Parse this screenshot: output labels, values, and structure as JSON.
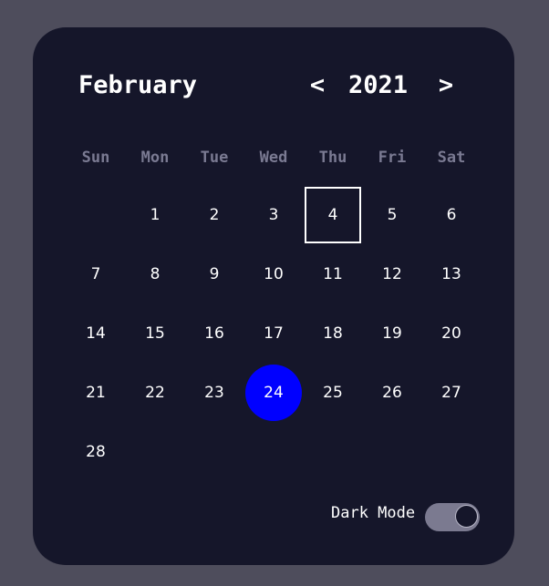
{
  "header": {
    "month": "February",
    "year": "2021",
    "prev_label": "<",
    "next_label": ">"
  },
  "weekdays": [
    "Sun",
    "Mon",
    "Tue",
    "Wed",
    "Thu",
    "Fri",
    "Sat"
  ],
  "first_weekday_index": 1,
  "days_in_month": 28,
  "today": 4,
  "selected": 24,
  "days": [
    "1",
    "2",
    "3",
    "4",
    "5",
    "6",
    "7",
    "8",
    "9",
    "10",
    "11",
    "12",
    "13",
    "14",
    "15",
    "16",
    "17",
    "18",
    "19",
    "20",
    "21",
    "22",
    "23",
    "24",
    "25",
    "26",
    "27",
    "28"
  ],
  "footer": {
    "dark_mode_label": "Dark Mode",
    "dark_mode_on": true
  },
  "colors": {
    "background": "#4e4d5c",
    "card": "#15162a",
    "selected": "#0000ff",
    "weekday_text": "#7a7a92",
    "toggle_track": "#7b7a90"
  }
}
